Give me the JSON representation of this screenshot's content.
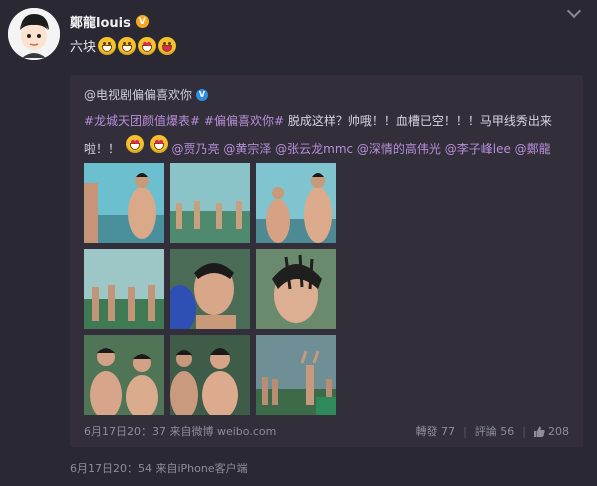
{
  "post": {
    "author": "鄭龍louis",
    "verified_badge": "V",
    "text": "六块",
    "emojis": [
      "grin",
      "grin",
      "heart-eyes",
      "tongue"
    ],
    "footer": "6月17日20：54 来自iPhone客户端"
  },
  "repost": {
    "author": "@电视剧偏偏喜欢你",
    "verified_badge": "V",
    "line1": {
      "tag1": "#龙城天团颜值爆表#",
      "tag2": "#偏偏喜欢你#",
      "text": "脱成这样？帅哦！！血槽已空！！！马甲线秀出来"
    },
    "line2": {
      "text": "啦！！",
      "mentions": "@贾乃亮 @黄宗泽 @张云龙mmc @深情的高伟光 @李子峰lee @鄭龍louis"
    },
    "meta": "6月17日20：37 来自微博 weibo.com",
    "reposts": "轉發 77",
    "comments": "評論 56",
    "likes": "208"
  },
  "colors": {
    "background": "#2a2933",
    "card": "#322f3b",
    "link": "#b88fd9",
    "muted": "#8e8d99",
    "gold_badge": "#f5a623",
    "blue_badge": "#2f8de0"
  }
}
